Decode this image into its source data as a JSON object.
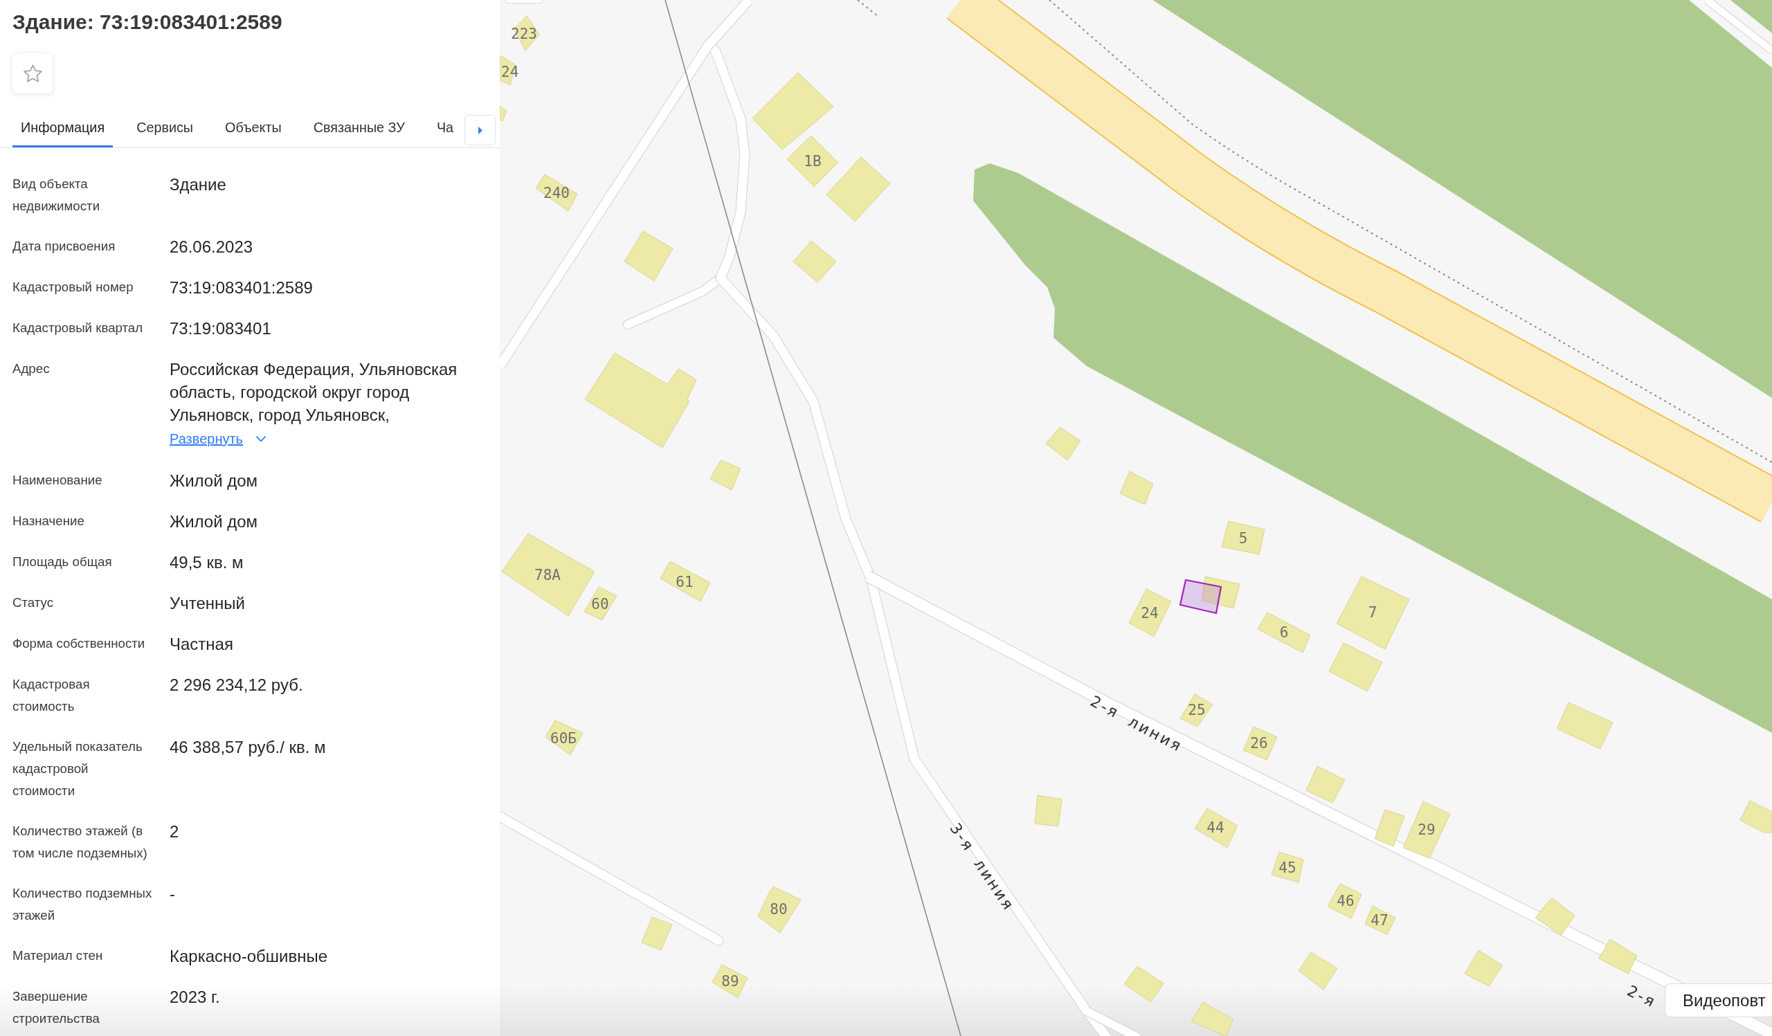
{
  "panel": {
    "title": "Здание: 73:19:083401:2589",
    "starred": false,
    "tabs": [
      {
        "label": "Информация",
        "selected": true
      },
      {
        "label": "Сервисы",
        "selected": false
      },
      {
        "label": "Объекты",
        "selected": false
      },
      {
        "label": "Связанные ЗУ",
        "selected": false
      },
      {
        "label": "Ча",
        "selected": false
      }
    ],
    "fields": [
      {
        "label": "Вид объекта недвижимости",
        "value": "Здание"
      },
      {
        "label": "Дата присвоения",
        "value": "26.06.2023"
      },
      {
        "label": "Кадастровый номер",
        "value": "73:19:083401:2589"
      },
      {
        "label": "Кадастровый квартал",
        "value": "73:19:083401"
      },
      {
        "label": "Адрес",
        "value": "Российская Федерация, Ульяновская область, городской округ город Ульяновск, город Ульяновск,",
        "link": "Развернуть"
      },
      {
        "label": "Наименование",
        "value": "Жилой дом"
      },
      {
        "label": "Назначение",
        "value": "Жилой дом"
      },
      {
        "label": "Площадь общая",
        "value": "49,5 кв. м"
      },
      {
        "label": "Статус",
        "value": "Учтенный"
      },
      {
        "label": "Форма собственности",
        "value": "Частная"
      },
      {
        "label": "Кадастровая стоимость",
        "value": "2 296 234,12 руб."
      },
      {
        "label": "Удельный показатель кадастровой стоимости",
        "value": "46 388,57 руб./ кв. м"
      },
      {
        "label": "Количество этажей (в том числе подземных)",
        "value": "2"
      },
      {
        "label": "Количество подземных этажей",
        "value": "-"
      },
      {
        "label": "Материал стен",
        "value": "Каркасно-обшивные"
      },
      {
        "label": "Завершение строительства",
        "value": "2023 г."
      }
    ]
  },
  "map": {
    "house_numbers": [
      "223",
      "24",
      "240",
      "1В",
      "78А",
      "61",
      "60",
      "5",
      "24",
      "6",
      "7",
      "25",
      "26",
      "60Б",
      "44",
      "29",
      "45",
      "46",
      "80",
      "47",
      "89"
    ],
    "street_labels": [
      "2-я линия",
      "3-я линия",
      "2-я"
    ],
    "tooltip": "Видеоповт"
  }
}
